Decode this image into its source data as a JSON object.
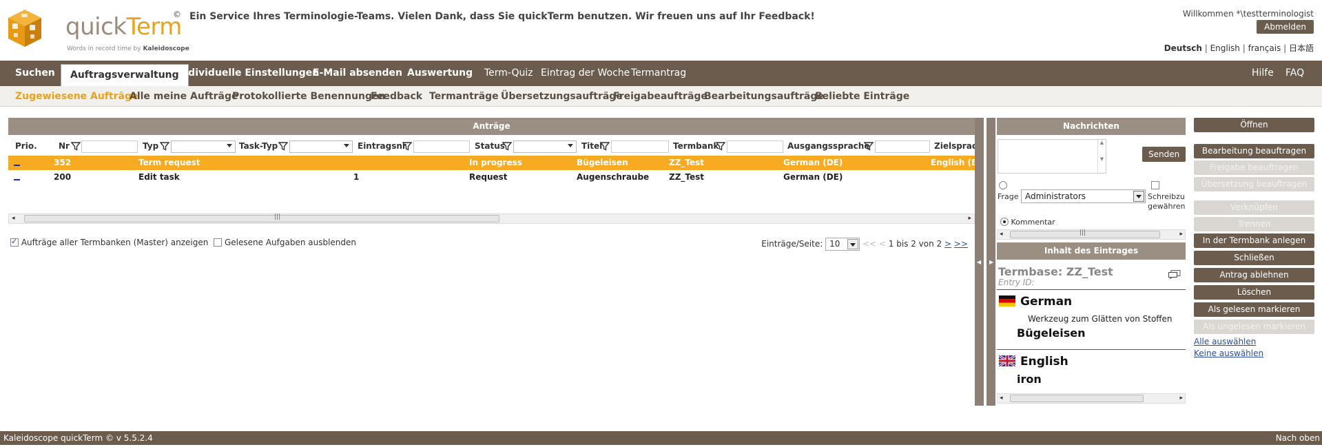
{
  "header": {
    "logo_text_a": "quick",
    "logo_text_b": "Term",
    "tagline_a": "Words in record time by ",
    "tagline_b": "Kaleidoscope",
    "copyright": "©",
    "service_message": "Ein Service Ihres Terminologie-Teams. Vielen Dank, dass Sie quickTerm benutzen. Wir freuen uns auf Ihr Feedback!",
    "welcome": "Willkommen *\\testterminologist",
    "logout": "Abmelden",
    "languages": [
      "Deutsch",
      "English",
      "français",
      "日本語"
    ],
    "language_separator": "|"
  },
  "main_nav": {
    "left": [
      "Suchen",
      "Auftragsverwaltung",
      "Individuelle Einstellungen",
      "E-Mail absenden",
      "Auswertung",
      "Term-Quiz",
      "Eintrag der Woche",
      "Termantrag"
    ],
    "active": "Auftragsverwaltung",
    "right": [
      "Hilfe",
      "FAQ"
    ]
  },
  "sub_nav": {
    "items": [
      "Zugewiesene Aufträge",
      "Alle meine Aufträge",
      "Protokollierte Benennungen",
      "Feedback",
      "Termanträge",
      "Übersetzungsaufträge",
      "Freigabeaufträge",
      "Bearbeitungsaufträge",
      "Beliebte Einträge"
    ],
    "active": "Zugewiesene Aufträge"
  },
  "tasks": {
    "title": "Anträge",
    "columns": [
      "Prio.",
      "Nr",
      "Typ",
      "Task-Typ",
      "Eintragsnr",
      "Status",
      "Titel",
      "Termbank",
      "Ausgangssprache",
      "Zielsprach"
    ],
    "rows": [
      {
        "nr": "352",
        "typ": "Term request",
        "tasktyp": "",
        "eintragsnr": "",
        "status": "In progress",
        "titel": "Bügeleisen",
        "termbank": "ZZ_Test",
        "ausgang": "German (DE)",
        "ziel": "English (EN",
        "selected": true
      },
      {
        "nr": "200",
        "typ": "Edit task",
        "tasktyp": "",
        "eintragsnr": "1",
        "status": "Request",
        "titel": "Augenschraube",
        "termbank": "ZZ_Test",
        "ausgang": "German (DE)",
        "ziel": "",
        "selected": false
      }
    ],
    "show_all_termbanks": "Aufträge aller Termbanken (Master) anzeigen",
    "hide_read": "Gelesene Aufgaben ausblenden",
    "per_page_label": "Einträge/Seite:",
    "per_page_value": "10",
    "pager_first": "<<",
    "pager_prev": "<",
    "pager_text": "1 bis 2 von 2",
    "pager_next": ">",
    "pager_last": ">>"
  },
  "messages": {
    "title": "Nachrichten",
    "send": "Senden",
    "question_label": "Frage an",
    "recipient": "Administrators",
    "write_access": "Schreibzugriff gewähren",
    "write_line1": "Schreibzu",
    "write_line2": "gewähren",
    "comment": "Kommentar"
  },
  "entry": {
    "title": "Inhalt des Eintrages",
    "termbase": "Termbase: ZZ_Test",
    "entry_id": "Entry ID:",
    "languages": [
      {
        "name": "German",
        "definition": "Werkzeug zum Glätten von Stoffen",
        "term": "Bügeleisen"
      },
      {
        "name": "English",
        "definition": "",
        "term": "iron"
      }
    ]
  },
  "actions": {
    "buttons": [
      {
        "label": "Öffnen",
        "enabled": true
      },
      {
        "label": "Bearbeitung beauftragen",
        "enabled": true
      },
      {
        "label": "Freigabe beauftragen",
        "enabled": false
      },
      {
        "label": "Übersetzung beauftragen",
        "enabled": false
      },
      {
        "label": "Verknüpfen",
        "enabled": false
      },
      {
        "label": "Trennen",
        "enabled": false
      },
      {
        "label": "In der Termbank anlegen",
        "enabled": true
      },
      {
        "label": "Schließen",
        "enabled": true
      },
      {
        "label": "Antrag ablehnen",
        "enabled": true
      },
      {
        "label": "Löschen",
        "enabled": true
      },
      {
        "label": "Als gelesen markieren",
        "enabled": true
      },
      {
        "label": "Als ungelesen markieren",
        "enabled": false
      }
    ],
    "select_all": "Alle auswählen",
    "select_none": "Keine auswählen"
  },
  "footer": {
    "version": "Kaleidoscope quickTerm © v 5.5.2.4",
    "top_link": "Nach oben"
  },
  "colors": {
    "brand_brown": "#6b5c4e",
    "accent_orange": "#f6ab22",
    "panel_header": "#9b8f83"
  }
}
